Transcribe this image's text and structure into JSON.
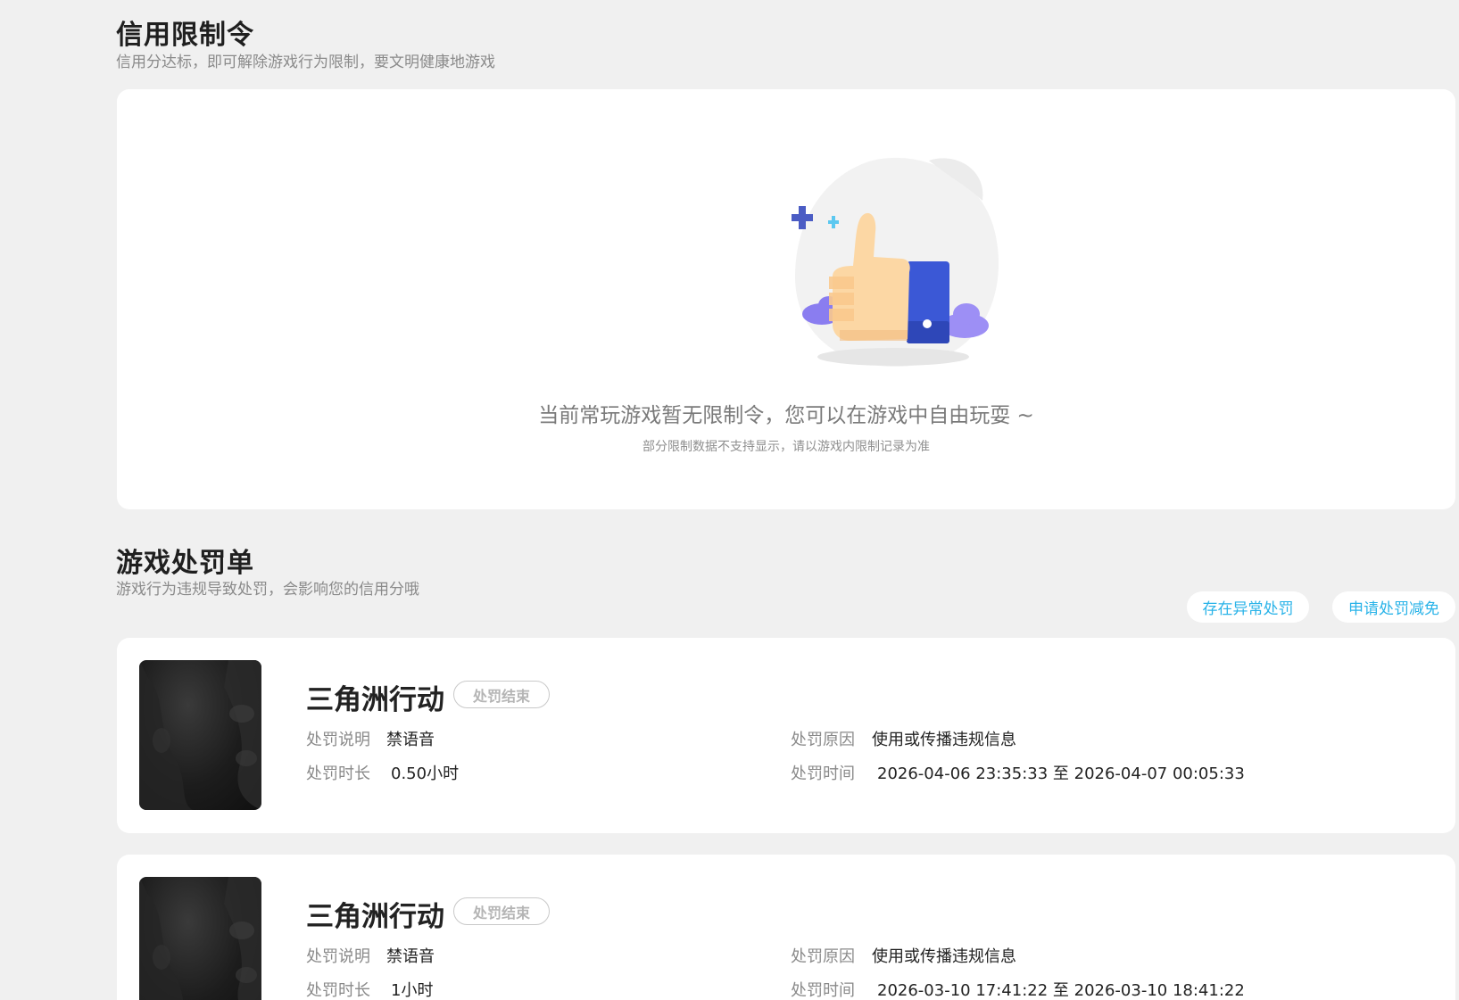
{
  "restriction": {
    "title": "信用限制令",
    "subtitle": "信用分达标，即可解除游戏行为限制，要文明健康地游戏",
    "empty_title": "当前常玩游戏暂无限制令，您可以在游戏中自由玩耍 ~",
    "empty_note": "部分限制数据不支持显示，请以游戏内限制记录为准"
  },
  "penalty": {
    "title": "游戏处罚单",
    "subtitle": "游戏行为违规导致处罚，会影响您的信用分哦",
    "btn_abnormal": "存在异常处罚",
    "btn_reduce": "申请处罚减免",
    "labels": {
      "desc": "处罚说明",
      "duration": "处罚时长",
      "reason": "处罚原因",
      "time": "处罚时间"
    },
    "items": [
      {
        "game": "三角洲行动",
        "status": "处罚结束",
        "desc": "禁语音",
        "duration": "0.50小时",
        "reason": "使用或传播违规信息",
        "time": "2026-04-06 23:35:33 至 2026-04-07 00:05:33"
      },
      {
        "game": "三角洲行动",
        "status": "处罚结束",
        "desc": "禁语音",
        "duration": "1小时",
        "reason": "使用或传播违规信息",
        "time": "2026-03-10 17:41:22 至 2026-03-10 18:41:22"
      }
    ]
  },
  "colors": {
    "accent": "#29b3e8",
    "page_bg": "#f0f0f0",
    "card_bg": "#ffffff",
    "thumb_blue": "#3b58d6",
    "thumb_skin": "#fcd7a4"
  },
  "icons": {
    "empty_illustration": "thumbs-up-illustration",
    "game_cover": "game-cover-image"
  }
}
